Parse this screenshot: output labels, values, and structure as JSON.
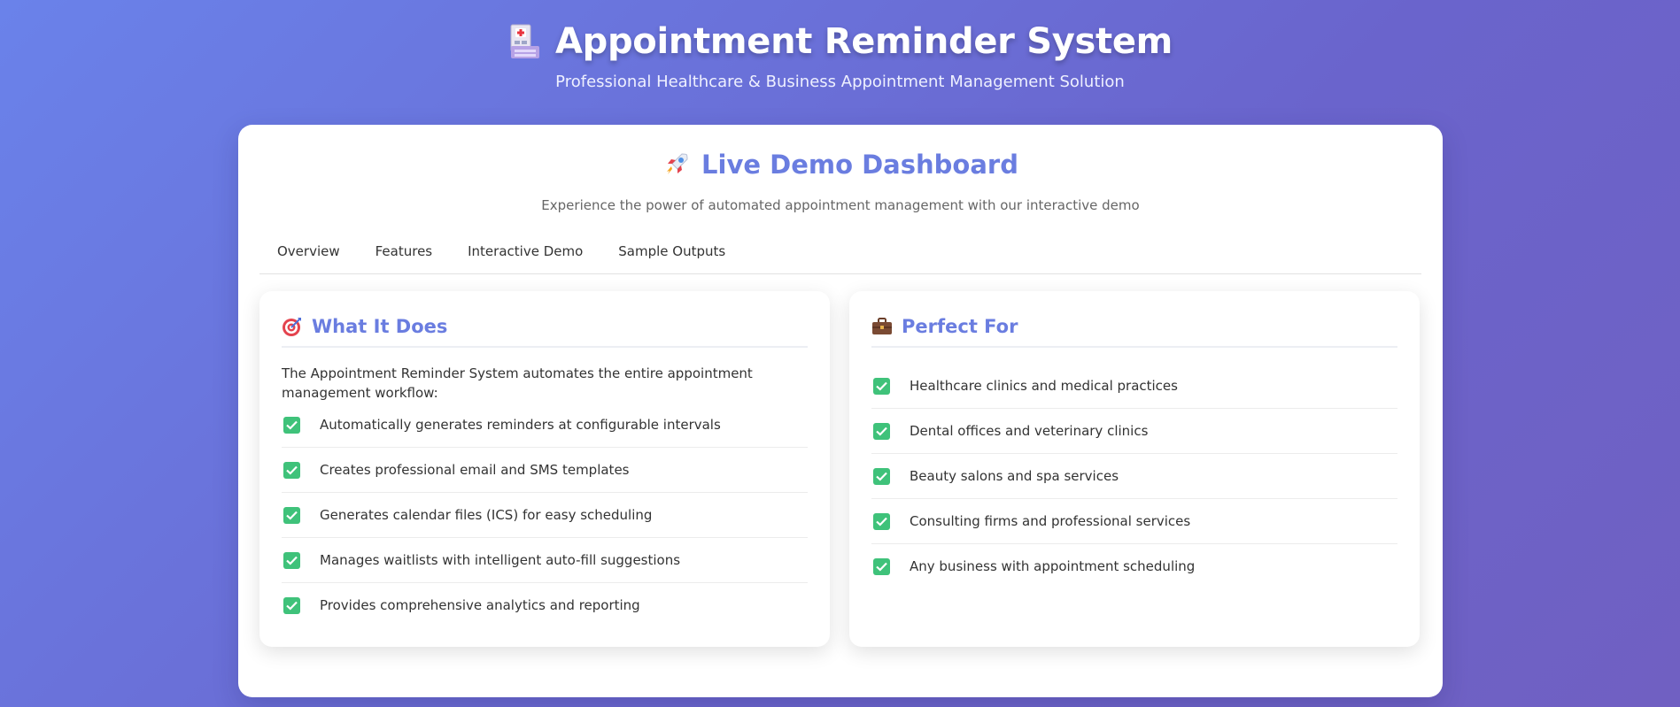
{
  "header": {
    "title": "Appointment Reminder System",
    "subtitle": "Professional Healthcare & Business Appointment Management Solution",
    "icon": "hospital-icon"
  },
  "dashboard": {
    "title": "Live Demo Dashboard",
    "icon": "rocket-icon",
    "subtitle": "Experience the power of automated appointment management with our interactive demo"
  },
  "tabs": [
    {
      "label": "Overview"
    },
    {
      "label": "Features"
    },
    {
      "label": "Interactive Demo"
    },
    {
      "label": "Sample Outputs"
    }
  ],
  "what_it_does": {
    "title": "What It Does",
    "icon": "target-icon",
    "description": "The Appointment Reminder System automates the entire appointment management workflow:",
    "items": [
      "Automatically generates reminders at configurable intervals",
      "Creates professional email and SMS templates",
      "Generates calendar files (ICS) for easy scheduling",
      "Manages waitlists with intelligent auto-fill suggestions",
      "Provides comprehensive analytics and reporting"
    ]
  },
  "perfect_for": {
    "title": "Perfect For",
    "icon": "briefcase-icon",
    "items": [
      "Healthcare clinics and medical practices",
      "Dental offices and veterinary clinics",
      "Beauty salons and spa services",
      "Consulting firms and professional services",
      "Any business with appointment scheduling"
    ]
  },
  "colors": {
    "accent": "#6a7de0",
    "check": "#3fc27a"
  }
}
